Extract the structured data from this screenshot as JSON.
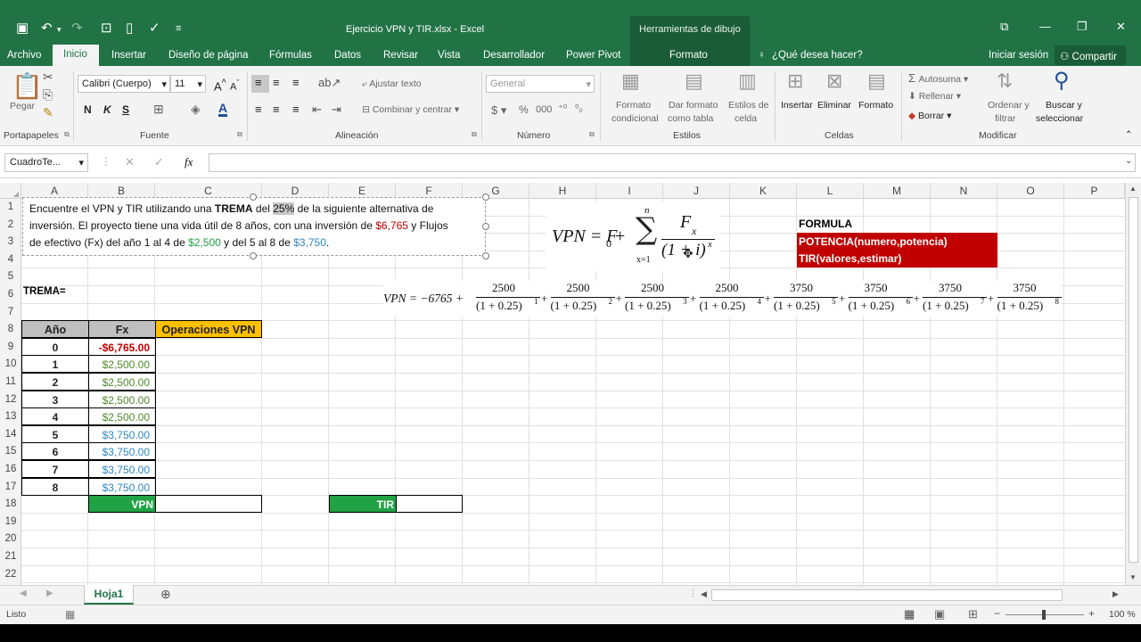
{
  "app": {
    "title": "Ejercicio VPN y TIR.xlsx - Excel",
    "context_tab_group": "Herramientas de dibujo",
    "tabs": [
      "Archivo",
      "Inicio",
      "Insertar",
      "Diseño de página",
      "Fórmulas",
      "Datos",
      "Revisar",
      "Vista",
      "Desarrollador",
      "Power Pivot",
      "Formato"
    ],
    "tell_me": "¿Qué desea hacer?",
    "signin": "Iniciar sesión",
    "share": "Compartir",
    "accent": "#217346"
  },
  "ribbon": {
    "groups": [
      "Portapapeles",
      "Fuente",
      "Alineación",
      "Número",
      "Estilos",
      "Celdas",
      "Modificar"
    ],
    "paste": "Pegar",
    "font_name": "Calibri (Cuerpo)",
    "font_size": "11",
    "bold": "N",
    "italic": "K",
    "underline": "S",
    "wrap_text": "Ajustar texto",
    "merge_center": "Combinar y centrar",
    "number_format": "General",
    "cond_format": [
      "Formato",
      "condicional"
    ],
    "format_table": [
      "Dar formato",
      "como tabla"
    ],
    "cell_styles": [
      "Estilos de",
      "celda"
    ],
    "insert": "Insertar",
    "delete": "Eliminar",
    "format": "Formato",
    "autosum": "Autosuma",
    "fill": "Rellenar",
    "clear": "Borrar",
    "sort_filter": [
      "Ordenar y",
      "filtrar"
    ],
    "find_select": [
      "Buscar y",
      "seleccionar"
    ]
  },
  "formula_bar": {
    "name_box": "CuadroTe...",
    "fx": "fx",
    "content": ""
  },
  "columns": [
    "A",
    "B",
    "C",
    "D",
    "E",
    "F",
    "G",
    "H",
    "I",
    "J",
    "K",
    "L",
    "M",
    "N",
    "O",
    "P"
  ],
  "rows": [
    "1",
    "2",
    "3",
    "4",
    "5",
    "6",
    "7",
    "8",
    "9",
    "10",
    "11",
    "12",
    "13",
    "14",
    "15",
    "16",
    "17",
    "18",
    "19",
    "20",
    "21",
    "22"
  ],
  "textbox": {
    "line1_a": "Encuentre el VPN y TIR utilizando una ",
    "line1_b": "TREMA",
    "line1_c": " del ",
    "line1_d": "25%",
    "line1_e": " de la siguiente alternativa de",
    "line2_a": "inversión. El proyecto tiene una vida útil de 8 años, con una inversión de ",
    "line2_b": "$6,765",
    "line2_c": " y Flujos",
    "line3_a": "de efectivo (Fx) del año 1 al 4 de ",
    "line3_b": "$2,500",
    "line3_c": " y del 5 al 8 de ",
    "line3_d": "$3,750",
    "line3_e": "."
  },
  "cells": {
    "trema_label": "TREMA=",
    "header_year": "Año",
    "header_fx": "Fx",
    "header_ops": "Operaciones VPN",
    "years": [
      "0",
      "1",
      "2",
      "3",
      "4",
      "5",
      "6",
      "7",
      "8"
    ],
    "fx": [
      "-$6,765.00",
      "$2,500.00",
      "$2,500.00",
      "$2,500.00",
      "$2,500.00",
      "$3,750.00",
      "$3,750.00",
      "$3,750.00",
      "$3,750.00"
    ],
    "vpn_label": "VPN",
    "tir_label": "TIR",
    "formula_title": "FORMULA",
    "formula_1": "POTENCIA(numero,potencia)",
    "formula_2": "TIR(valores,estimar)"
  },
  "equation": {
    "lhs": "VPN = F",
    "sub0": "0",
    "plus": " + ",
    "sum_top": "n",
    "sum_bottom": "x=1",
    "num": "F",
    "num_sub": "x",
    "den": "(1 + i)",
    "den_exp": "x"
  },
  "expansion": {
    "lhs": "VPN = −6765 +",
    "terms": [
      {
        "num": "2500",
        "den": "(1 + 0.25)",
        "exp": "1"
      },
      {
        "num": "2500",
        "den": "(1 + 0.25)",
        "exp": "2"
      },
      {
        "num": "2500",
        "den": "(1 + 0.25)",
        "exp": "3"
      },
      {
        "num": "2500",
        "den": "(1 + 0.25)",
        "exp": "4"
      },
      {
        "num": "3750",
        "den": "(1 + 0.25)",
        "exp": "5"
      },
      {
        "num": "3750",
        "den": "(1 + 0.25)",
        "exp": "6"
      },
      {
        "num": "3750",
        "den": "(1 + 0.25)",
        "exp": "7"
      },
      {
        "num": "3750",
        "den": "(1 + 0.25)",
        "exp": "8"
      }
    ]
  },
  "sheet": {
    "tab": "Hoja1"
  },
  "status": {
    "ready": "Listo",
    "zoom": "100 %"
  }
}
